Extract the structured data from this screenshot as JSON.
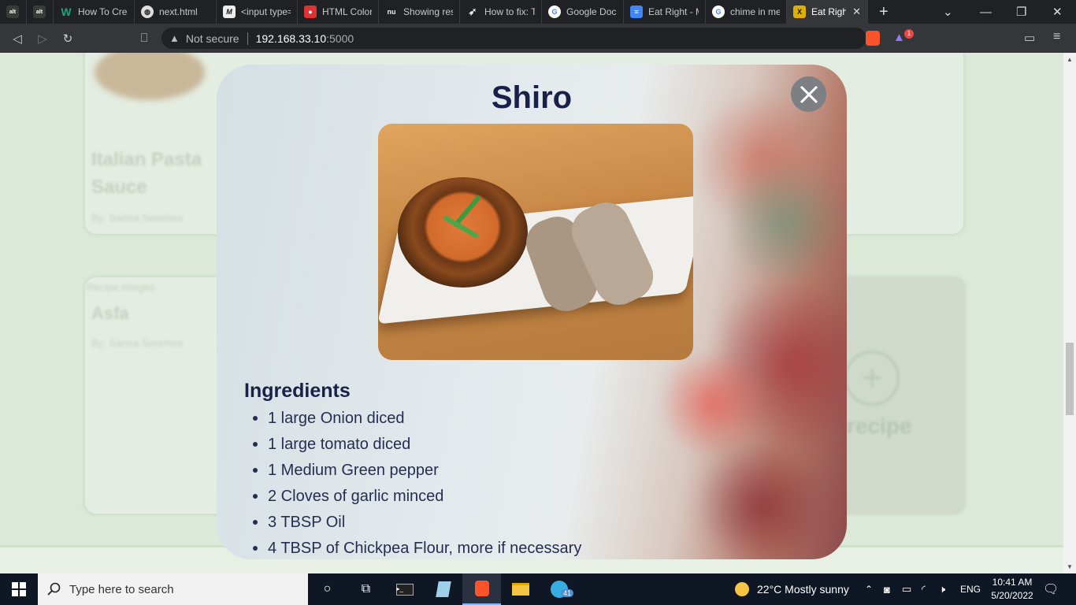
{
  "browser": {
    "tabs": [
      {
        "title": "",
        "icon": "alt-icon",
        "color": "#444"
      },
      {
        "title": "",
        "icon": "alt-icon",
        "color": "#444"
      },
      {
        "title": "How To Crea",
        "icon": "w-icon",
        "color": "#1fa37c"
      },
      {
        "title": "next.html",
        "icon": "globe-icon",
        "color": "#555"
      },
      {
        "title": "<input type=",
        "icon": "m-icon",
        "color": "#333"
      },
      {
        "title": "HTML Color",
        "icon": "red-square-icon",
        "color": "#d33"
      },
      {
        "title": "Showing resu",
        "icon": "nu-icon",
        "color": "#222"
      },
      {
        "title": "How to fix: T",
        "icon": "rocket-icon",
        "color": "#222"
      },
      {
        "title": "Google Docs",
        "icon": "google-icon",
        "color": "#fff"
      },
      {
        "title": "Eat Right - M",
        "icon": "docs-icon",
        "color": "#4285f4"
      },
      {
        "title": "chime in me",
        "icon": "google-icon",
        "color": "#fff"
      },
      {
        "title": "Eat Righ",
        "icon": "x-icon",
        "color": "#e0b000"
      }
    ],
    "address": {
      "security": "Not secure",
      "host": "192.168.33.10",
      "port": ":5000"
    },
    "brave_badge": "1"
  },
  "backdrop": {
    "card1_title_line1": "Italian Pasta",
    "card1_title_line2": "Sauce",
    "card1_author": "By: Samra Seremes",
    "card2_alt": "Recipe Images",
    "card2_title": "Asfa",
    "card2_author": "By: Samra Seremes",
    "add_recipe_text": "recipe"
  },
  "modal": {
    "title": "Shiro",
    "ingredients_heading": "Ingredients",
    "ingredients": [
      "1 large Onion diced",
      "1 large tomato diced",
      "1 Medium Green pepper",
      "2 Cloves of garlic minced",
      "3 TBSP Oil",
      "4 TBSP of Chickpea Flour, more if necessary"
    ]
  },
  "taskbar": {
    "search_placeholder": "Type here to search",
    "weather": "22°C  Mostly sunny",
    "language": "ENG",
    "time": "10:41 AM",
    "date": "5/20/2022",
    "telegram_badge": "41"
  }
}
